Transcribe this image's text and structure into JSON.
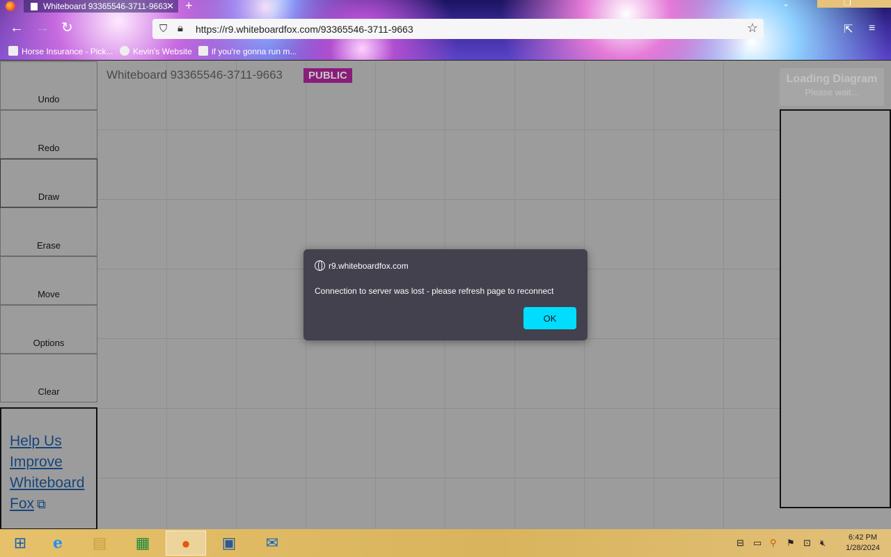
{
  "browser": {
    "tab_title": "Whiteboard 93365546-3711-9663",
    "url": "https://r9.whiteboardfox.com/93365546-3711-9663",
    "bookmarks": [
      {
        "label": "Horse Insurance - Pick..."
      },
      {
        "label": "Kevin's Website"
      },
      {
        "label": "if you're gonna run m..."
      }
    ]
  },
  "toolbar": {
    "buttons": [
      {
        "label": "Undo"
      },
      {
        "label": "Redo"
      },
      {
        "label": "Draw"
      },
      {
        "label": "Erase"
      },
      {
        "label": "Move"
      },
      {
        "label": "Options"
      },
      {
        "label": "Clear"
      }
    ],
    "help_link": [
      "Help Us",
      "Improve",
      "Whiteboard",
      "Fox"
    ]
  },
  "board": {
    "title": "Whiteboard 93365546-3711-9663",
    "badge": "PUBLIC",
    "loading_title": "Loading Diagram",
    "loading_sub": "Please wait..."
  },
  "dialog": {
    "host": "r9.whiteboardfox.com",
    "message": "Connection to server was lost - please refresh page to reconnect",
    "ok_label": "OK"
  },
  "taskbar": {
    "time": "6:42 PM",
    "date": "1/28/2024"
  },
  "colors": {
    "dialog_bg": "#42414d",
    "ok_button": "#00ddff",
    "public_badge": "#8a1c7a",
    "link": "#17457a"
  }
}
